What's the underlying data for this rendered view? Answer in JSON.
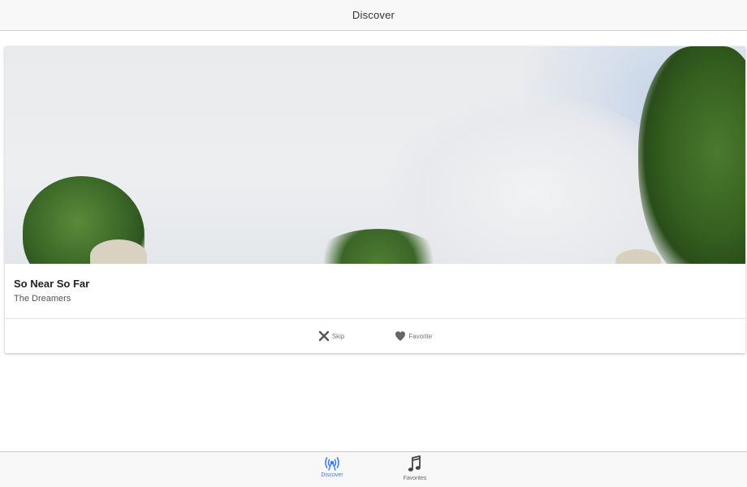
{
  "header": {
    "title": "Discover"
  },
  "card": {
    "cover_alt": "album cover photo",
    "song_title": "So Near So Far",
    "artist": "The Dreamers",
    "actions": {
      "skip_label": "Skip",
      "favorite_label": "Favorite"
    }
  },
  "tabs": [
    {
      "label": "Discover",
      "icon": "radio-waves-icon",
      "active": true
    },
    {
      "label": "Favorites",
      "icon": "music-note-icon",
      "active": false
    }
  ],
  "colors": {
    "accent": "#3b7cf5",
    "bar_background": "#f8f8f8",
    "icon_gray": "#555555"
  }
}
